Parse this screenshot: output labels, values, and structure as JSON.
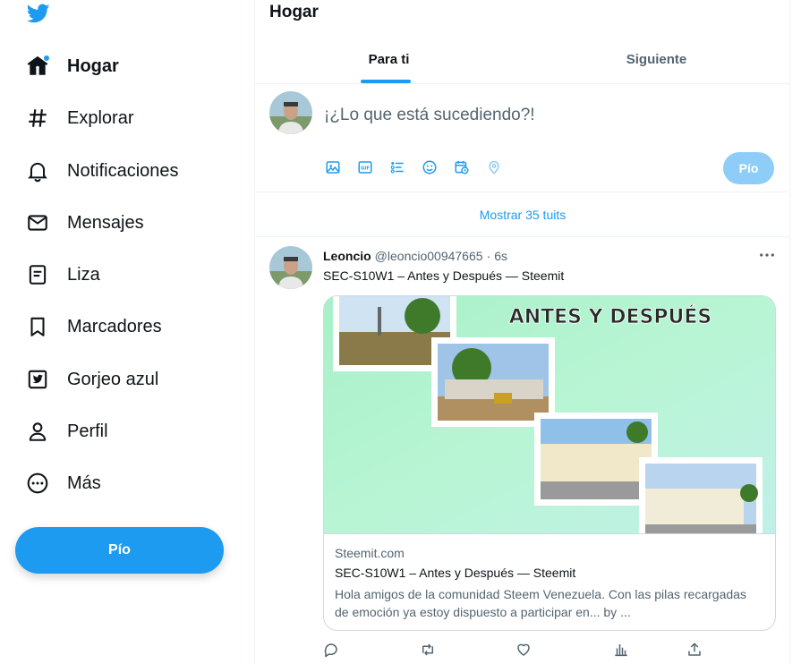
{
  "sidebar": {
    "logo": "twitter-bird-icon",
    "items": [
      {
        "label": "Hogar",
        "icon": "home-icon",
        "active": true,
        "badge": true
      },
      {
        "label": "Explorar",
        "icon": "hashtag-icon"
      },
      {
        "label": "Notificaciones",
        "icon": "bell-icon"
      },
      {
        "label": "Mensajes",
        "icon": "envelope-icon"
      },
      {
        "label": "Liza",
        "icon": "list-icon"
      },
      {
        "label": "Marcadores",
        "icon": "bookmark-icon"
      },
      {
        "label": "Gorjeo azul",
        "icon": "twitter-blue-icon"
      },
      {
        "label": "Perfil",
        "icon": "person-icon"
      },
      {
        "label": "Más",
        "icon": "more-circle-icon"
      }
    ],
    "tweet_button": "Pío"
  },
  "header": {
    "title": "Hogar",
    "tabs": [
      {
        "label": "Para ti",
        "active": true
      },
      {
        "label": "Siguiente",
        "active": false
      }
    ]
  },
  "composer": {
    "placeholder": "¡¿Lo que está sucediendo?!",
    "tools": [
      "image-icon",
      "gif-icon",
      "poll-icon",
      "emoji-icon",
      "schedule-icon",
      "location-icon"
    ],
    "submit_label": "Pío"
  },
  "show_more": "Mostrar 35 tuits",
  "tweet": {
    "name": "Leoncio",
    "handle": "@leoncio00947665",
    "separator": "·",
    "time": "6s",
    "text": "SEC-S10W1 – Antes y Después — Steemit",
    "card": {
      "image_title": "ANTES Y DESPUÉS",
      "domain": "Steemit.com",
      "title": "SEC-S10W1 – Antes y Después — Steemit",
      "description": "Hola amigos de la comunidad Steem Venezuela. Con las pilas recargadas de emoción ya estoy dispuesto a participar en... by ..."
    },
    "actions": [
      "reply-icon",
      "retweet-icon",
      "like-icon",
      "views-icon",
      "share-icon"
    ]
  },
  "colors": {
    "accent": "#1d9bf0",
    "accent_disabled": "#8ecdf8",
    "text_primary": "#0f1419",
    "text_secondary": "#536471",
    "border": "#eff3f4"
  }
}
